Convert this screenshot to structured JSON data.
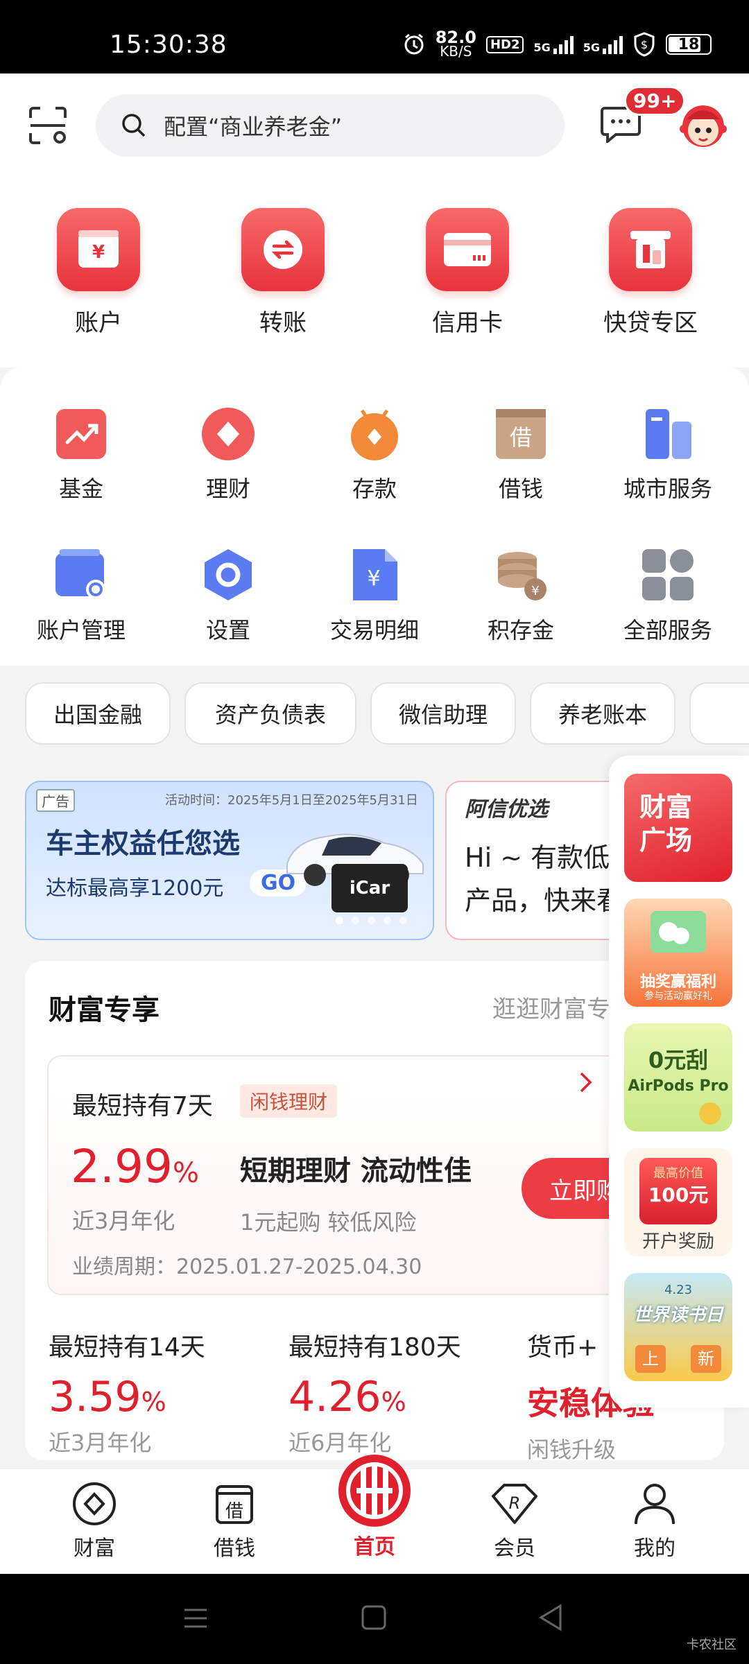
{
  "status": {
    "time": "15:30:38",
    "speed_value": "82.0",
    "speed_unit": "KB/S",
    "hd": "HD2",
    "net1": "5G",
    "net2": "5G",
    "battery": "18"
  },
  "header": {
    "search_placeholder": "配置“商业养老金”",
    "message_badge": "99+"
  },
  "top_nav": [
    {
      "label": "账户",
      "icon": "wallet-yuan-icon"
    },
    {
      "label": "转账",
      "icon": "transfer-icon"
    },
    {
      "label": "信用卡",
      "icon": "credit-card-icon"
    },
    {
      "label": "快贷专区",
      "icon": "quick-loan-icon"
    }
  ],
  "services": [
    {
      "label": "基金",
      "icon": "fund-trend-icon",
      "color": "#f05a5a"
    },
    {
      "label": "理财",
      "icon": "diamond-icon",
      "color": "#f05a5a"
    },
    {
      "label": "存款",
      "icon": "deposit-icon",
      "color": "#f28a3a"
    },
    {
      "label": "借钱",
      "icon": "borrow-icon",
      "color": "#b08a6a"
    },
    {
      "label": "城市服务",
      "icon": "city-building-icon",
      "color": "#5b7cf0"
    },
    {
      "label": "账户管理",
      "icon": "account-manage-icon",
      "color": "#5b7cf0"
    },
    {
      "label": "设置",
      "icon": "settings-hex-icon",
      "color": "#5b7cf0"
    },
    {
      "label": "交易明细",
      "icon": "transaction-detail-icon",
      "color": "#5b7cf0"
    },
    {
      "label": "积存金",
      "icon": "gold-coins-icon",
      "color": "#b08a6a"
    },
    {
      "label": "全部服务",
      "icon": "all-services-grid-icon",
      "color": "#8a8f99"
    }
  ],
  "chips": [
    "出国金融",
    "资产负债表",
    "微信助理",
    "养老账本"
  ],
  "banner1": {
    "ad_tag": "广告",
    "period": "活动时间：2025年5月1日至2025年5月31日",
    "title": "车主权益任您选",
    "subtitle": "达标最高享1200元",
    "go": "GO",
    "card_brand": "iCar"
  },
  "banner2": {
    "brand": "阿信优选",
    "line1": "Hi ~ 有款低",
    "line2": "产品，快来看看！"
  },
  "wealth": {
    "title": "财富专享",
    "more": "逛逛财富专区",
    "main_product": {
      "holding": "最短持有7天",
      "tag": "闲钱理财",
      "rate": "2.99",
      "rate_unit": "%",
      "rate_label": "近3月年化",
      "headline": "短期理财 流动性佳",
      "sub": "1元起购 较低风险",
      "period": "业绩周期：2025.01.27-2025.04.30",
      "buy": "立即购"
    },
    "products": [
      {
        "holding": "最短持有14天",
        "rate": "3.59",
        "unit": "%",
        "label": "近3月年化"
      },
      {
        "holding": "最短持有180天",
        "rate": "4.26",
        "unit": "%",
        "label": "近6月年化"
      },
      {
        "holding": "货币+",
        "rate": "安稳体验",
        "unit": "",
        "label": "闲钱升级"
      }
    ]
  },
  "side": {
    "card1": "财富广场",
    "card2_title": "抽奖赢福利",
    "card2_sub": "参与活动赢好礼",
    "card3_line1": "0元刮",
    "card3_line2": "AirPods Pro",
    "card4_top": "最高价值",
    "card4_value": "100元",
    "card4_label": "开户奖励",
    "card5_date": "4.23",
    "card5_title": "世界读书日",
    "card5_badge1": "上",
    "card5_badge2": "新"
  },
  "bottom_nav": [
    {
      "label": "财富",
      "icon": "wealth-diamond-icon",
      "active": false
    },
    {
      "label": "借钱",
      "icon": "borrow-tab-icon",
      "active": false
    },
    {
      "label": "首页",
      "icon": "citic-logo-icon",
      "active": true
    },
    {
      "label": "会员",
      "icon": "member-r-icon",
      "active": false
    },
    {
      "label": "我的",
      "icon": "profile-icon",
      "active": false
    }
  ],
  "watermark": "卡农社区"
}
